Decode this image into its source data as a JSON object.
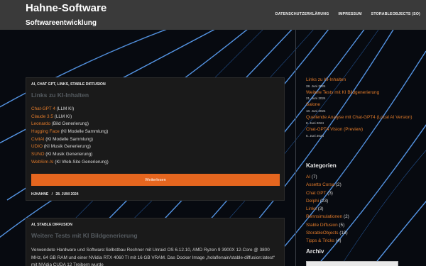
{
  "header": {
    "title": "Hahne-Software",
    "tagline": "Softwareentwicklung",
    "nav": [
      "DATENSCHUTZERKLÄRUNG",
      "IMPRESSUM",
      "STORABLEOBJECTS (SO)"
    ]
  },
  "post1": {
    "categories": "AI, CHAT GPT, LINKS, STABLE DIFFUSION",
    "title": "Links zu KI-Inhalten",
    "links": [
      {
        "link": "Chat-GPT 4",
        "desc": " (LLM KI)"
      },
      {
        "link": "Claude 3.5",
        "desc": " (LLM KI)"
      },
      {
        "link": "Leonardo",
        "desc": " (Bild Generierung)"
      },
      {
        "link": "Hugging Face",
        "desc": " (KI Modelle Sammlung)"
      },
      {
        "link": "CivitAI",
        "desc": " (KI Modelle Sammlung)"
      },
      {
        "link": "UDIO",
        "desc": " (KI Musik Generierung)"
      },
      {
        "link": "SUNO",
        "desc": " (KI Musik Generierung)"
      },
      {
        "link": "WebSim AI",
        "desc": " (KI Web-Site Generierung)"
      }
    ],
    "more": "Weiterlesen",
    "author": "HJHAHNE",
    "separator": "/",
    "date": "28. JUNI 2024"
  },
  "post2": {
    "categories": "AI, STABLE DIFFUSION",
    "title": "Weitere Tests mit KI Bildgenerierung",
    "excerpt": "Verwendete Hardware und Software:Selbstbau Rechner mit Unraid OS 6.12.10, AMD Ryzen 9 3900X 12-Core @ 3800 MHz, 64 GB RAM und einer NVidia RTX 4060 TI mit 16 GB VRAM. Das Docker Image „holaflenain/stable-diffusion:latest“ mit NVidia CUDA 12 Treibern wurde"
  },
  "sidebar": {
    "recent": [
      {
        "title": "Links zu KI-Inhalten",
        "date": "28. Juni 2024"
      },
      {
        "title": "Weitere Tests mit KI Bildgenerierung",
        "date": "21. Juni 2024"
      },
      {
        "title": "Salone",
        "date": "10. Juni 2024"
      },
      {
        "title": "Quellende Analyse mit Chat-GPT4 (Local AI Version)",
        "date": "8. Juni 2024"
      },
      {
        "title": "Chat-GPT4 Vision (Preview)",
        "date": "6. Juni 2024"
      }
    ],
    "kategorien_title": "Kategorien",
    "categories": [
      {
        "name": "AI",
        "count": " (7)"
      },
      {
        "name": "Assetto Corsa",
        "count": " (2)"
      },
      {
        "name": "Chat GPT",
        "count": " (3)"
      },
      {
        "name": "Delphi",
        "count": " (23)"
      },
      {
        "name": "Links",
        "count": " (3)"
      },
      {
        "name": "Rennsimulationen",
        "count": " (2)"
      },
      {
        "name": "Stable Diffusion",
        "count": " (5)"
      },
      {
        "name": "StorableObjects",
        "count": " (18)"
      },
      {
        "name": "Tipps & Tricks",
        "count": " (4)"
      }
    ],
    "archiv_title": "Archiv"
  },
  "colors": {
    "accent": "#e07a2a",
    "button": "#e5661f",
    "header": "#3a3a3a"
  }
}
